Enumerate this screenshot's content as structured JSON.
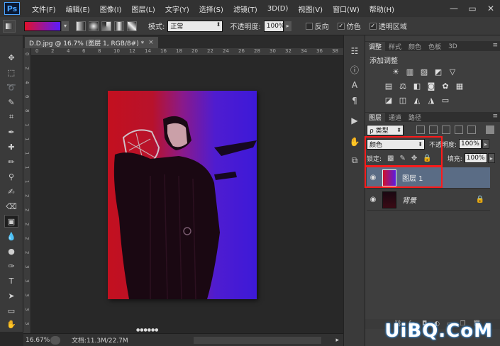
{
  "app": {
    "logo": "Ps",
    "menu": [
      "文件(F)",
      "编辑(E)",
      "图像(I)",
      "图层(L)",
      "文字(Y)",
      "选择(S)",
      "滤镜(T)",
      "3D(D)",
      "视图(V)",
      "窗口(W)",
      "帮助(H)"
    ],
    "window_controls": [
      "—",
      "▭",
      "✕"
    ]
  },
  "options": {
    "mode_label": "模式:",
    "mode_value": "正常",
    "opacity_label": "不透明度:",
    "opacity_value": "100%",
    "reverse_label": "反向",
    "dither_label": "仿色",
    "transparency_label": "透明区域",
    "gradient_colors": [
      "#e0102a",
      "#5a1cff"
    ]
  },
  "document": {
    "tab_title": "D.D.jpg @ 16.7% (图层 1, RGB/8#) *",
    "ruler_top": [
      "0",
      "2",
      "4",
      "6",
      "8",
      "10",
      "12",
      "14",
      "16",
      "18",
      "20",
      "22",
      "24",
      "26",
      "28",
      "30",
      "32",
      "34",
      "36",
      "38"
    ],
    "ruler_left": [
      "0",
      "2",
      "4",
      "6",
      "8",
      "1",
      "1",
      "1",
      "1",
      "1",
      "2",
      "2",
      "2",
      "2",
      "2",
      "3",
      "3",
      "3",
      "3",
      "3"
    ],
    "watermark_small": "●●●●●●"
  },
  "status": {
    "zoom": "16.67%",
    "doc_info": "文档:11.3M/22.7M"
  },
  "adjustments": {
    "tabs": [
      "调整",
      "样式",
      "颜色",
      "色板",
      "3D"
    ],
    "title": "添加调整"
  },
  "layers": {
    "tabs": [
      "图层",
      "通道",
      "路径"
    ],
    "filter_kind": "ρ 类型",
    "blend_mode": "颜色",
    "opacity_label": "不透明度:",
    "opacity_value": "100%",
    "lock_label": "锁定:",
    "fill_label": "填充:",
    "fill_value": "100%",
    "items": [
      {
        "name": "图层 1",
        "selected": true
      },
      {
        "name": "背景",
        "selected": false
      }
    ]
  },
  "watermark": "UiBQ.CoM",
  "colors": {
    "accent_highlight": "#ff1a1a",
    "selection": "#5a6c85",
    "gradient_start": "#c3101f",
    "gradient_end": "#3d19d8"
  }
}
